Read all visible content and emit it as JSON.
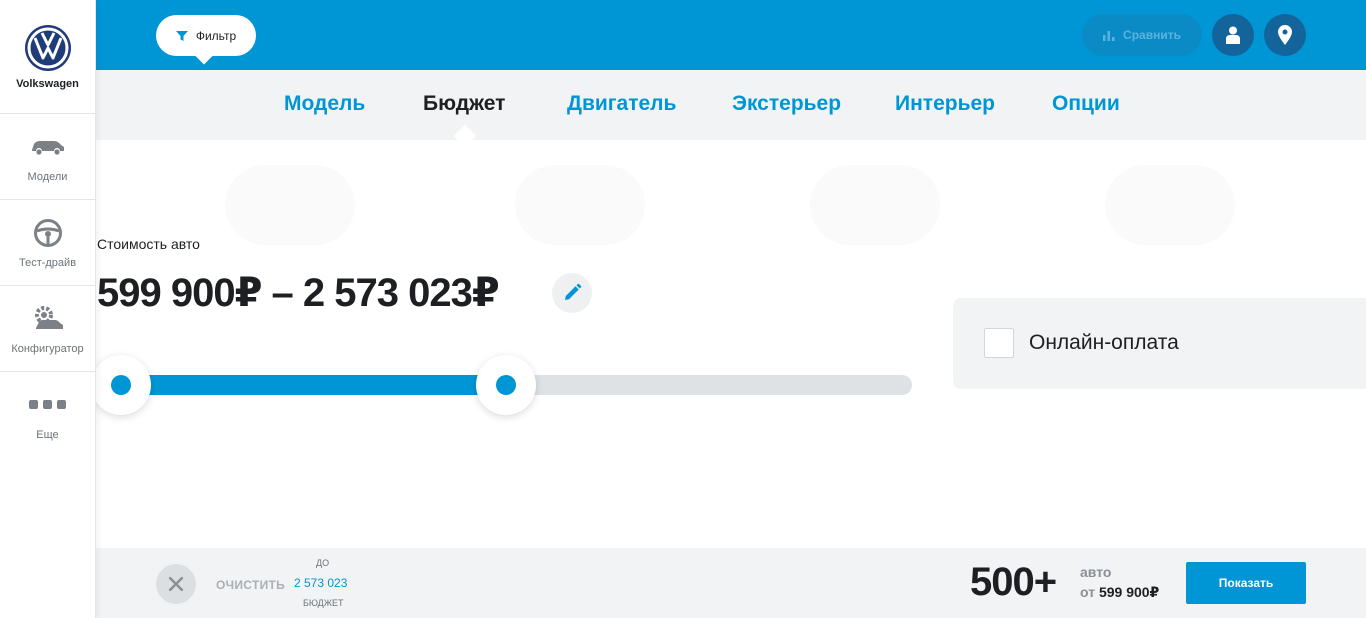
{
  "brand": {
    "name": "Volkswagen",
    "logo_icon": "vw-logo-icon"
  },
  "sidebar": {
    "items": [
      {
        "label": "Модели",
        "icon": "car-icon"
      },
      {
        "label": "Тест-драйв",
        "icon": "steering-wheel-icon"
      },
      {
        "label": "Конфигуратор",
        "icon": "configurator-gear-car-icon"
      },
      {
        "label": "Еще",
        "icon": "more-dots-icon"
      }
    ]
  },
  "header": {
    "filter_label": "Фильтр",
    "compare_label": "Сравнить",
    "user_icon": "user-icon",
    "location_icon": "location-pin-icon"
  },
  "tabs": [
    {
      "label": "Модель",
      "active": false
    },
    {
      "label": "Бюджет",
      "active": true
    },
    {
      "label": "Двигатель",
      "active": false
    },
    {
      "label": "Экстерьер",
      "active": false
    },
    {
      "label": "Интерьер",
      "active": false
    },
    {
      "label": "Опции",
      "active": false
    }
  ],
  "budget": {
    "label": "Стоимость авто",
    "range_text": "599 900₽ – 2 573 023₽",
    "min_thumb_fraction": 0.0,
    "max_thumb_fraction": 0.5
  },
  "online_payment": {
    "label": "Онлайн-оплата",
    "checked": false
  },
  "footer": {
    "clear_label": "ОЧИСТИТЬ",
    "summary_prefix": "ДО",
    "summary_value": "2 573 023",
    "summary_suffix": "БЮДЖЕТ",
    "count": "500+",
    "count_unit": "авто",
    "from_prefix": "от",
    "from_price": "599 900₽",
    "show_label": "Показать"
  },
  "colors": {
    "accent": "#0096d6",
    "dark": "#1d1f22",
    "muted": "#6c7379",
    "panel": "#f2f3f4"
  }
}
